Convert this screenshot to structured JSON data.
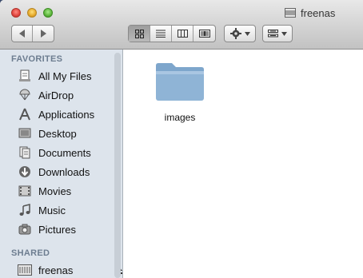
{
  "window": {
    "title": "freenas"
  },
  "sidebar": {
    "sections": [
      {
        "label": "FAVORITES"
      },
      {
        "label": "SHARED"
      }
    ],
    "favorites": [
      {
        "label": "All My Files",
        "icon": "all-files-icon"
      },
      {
        "label": "AirDrop",
        "icon": "airdrop-icon"
      },
      {
        "label": "Applications",
        "icon": "applications-icon"
      },
      {
        "label": "Desktop",
        "icon": "desktop-icon"
      },
      {
        "label": "Documents",
        "icon": "documents-icon"
      },
      {
        "label": "Downloads",
        "icon": "downloads-icon"
      },
      {
        "label": "Movies",
        "icon": "movies-icon"
      },
      {
        "label": "Music",
        "icon": "music-icon"
      },
      {
        "label": "Pictures",
        "icon": "pictures-icon"
      }
    ],
    "shared": [
      {
        "label": "freenas",
        "icon": "server-icon"
      }
    ]
  },
  "content": {
    "items": [
      {
        "label": "images",
        "icon": "folder-icon"
      }
    ]
  },
  "colors": {
    "sidebar_bg": "#dde4ec",
    "section_header": "#6d7d90",
    "folder": "#8fb4d6"
  }
}
